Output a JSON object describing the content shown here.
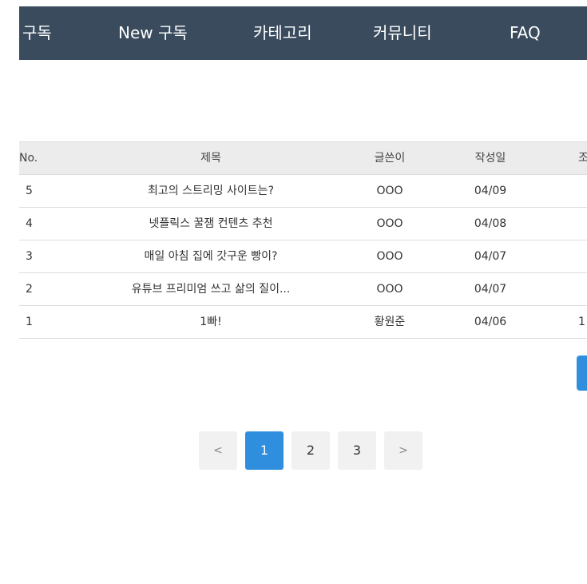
{
  "nav": {
    "items": [
      "구독",
      "New 구독",
      "카테고리",
      "커뮤니티",
      "FAQ"
    ]
  },
  "board": {
    "headers": {
      "no": "No.",
      "title": "제목",
      "author": "글쓴이",
      "date": "작성일",
      "extra": "조"
    },
    "rows": [
      {
        "no": "5",
        "title": "최고의 스트리밍 사이트는?",
        "author": "OOO",
        "date": "04/09",
        "extra": ""
      },
      {
        "no": "4",
        "title": "넷플릭스 꿀잼 컨텐츠 추천",
        "author": "OOO",
        "date": "04/08",
        "extra": ""
      },
      {
        "no": "3",
        "title": "매일 아침 집에 갓구운 빵이?",
        "author": "OOO",
        "date": "04/07",
        "extra": ""
      },
      {
        "no": "2",
        "title": "유튜브 프리미엄 쓰고 삶의 질이...",
        "author": "OOO",
        "date": "04/07",
        "extra": ""
      },
      {
        "no": "1",
        "title": "1빠!",
        "author": "황원준",
        "date": "04/06",
        "extra": "1"
      }
    ]
  },
  "pagination": {
    "prev": "<",
    "pages": [
      "1",
      "2",
      "3"
    ],
    "next": ">",
    "current": "1"
  },
  "colors": {
    "nav_bg": "#3a4b5e",
    "accent": "#2f8fde",
    "header_bg": "#ececec"
  }
}
